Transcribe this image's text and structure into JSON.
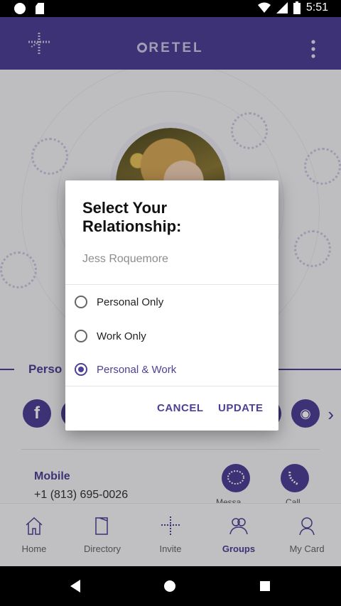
{
  "status_bar": {
    "time": "5:51"
  },
  "app_bar": {
    "brand": "RETEL"
  },
  "profile": {
    "section_title": "Perso",
    "mobile_label": "Mobile",
    "mobile_value": "+1 (813) 695-0026",
    "actions": [
      "Messa",
      "Call"
    ]
  },
  "dialog": {
    "title": "Select Your Relationship:",
    "subtitle": "Jess Roquemore",
    "options": [
      {
        "label": "Personal Only",
        "selected": false
      },
      {
        "label": "Work Only",
        "selected": false
      },
      {
        "label": "Personal & Work",
        "selected": true
      }
    ],
    "cancel_label": "CANCEL",
    "update_label": "UPDATE"
  },
  "bottom_nav": {
    "items": [
      {
        "label": "Home",
        "icon": "home-icon",
        "active": false
      },
      {
        "label": "Directory",
        "icon": "directory-icon",
        "active": false
      },
      {
        "label": "Invite",
        "icon": "invite-icon",
        "active": false
      },
      {
        "label": "Groups",
        "icon": "groups-icon",
        "active": true
      },
      {
        "label": "My Card",
        "icon": "my-card-icon",
        "active": false
      }
    ]
  },
  "colors": {
    "accent": "#4d4196"
  }
}
